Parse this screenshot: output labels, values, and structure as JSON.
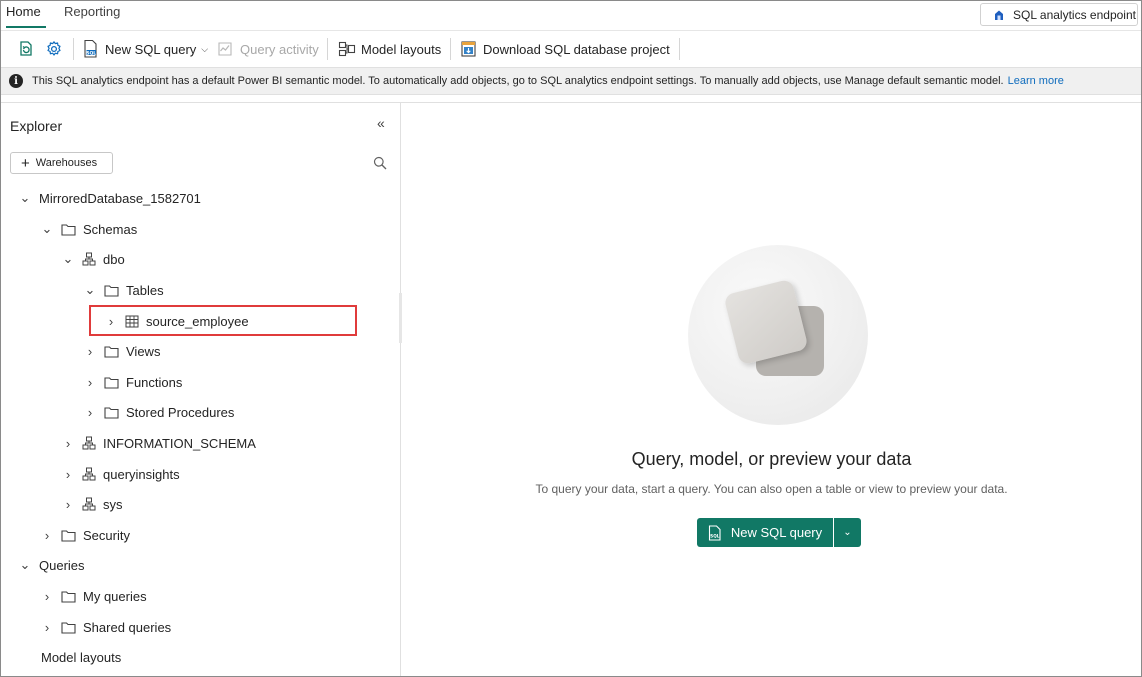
{
  "tabs": {
    "home": "Home",
    "reporting": "Reporting"
  },
  "endpoint_selector": {
    "label": "SQL analytics endpoint"
  },
  "toolbar": {
    "new_sql_query": "New SQL query",
    "query_activity": "Query activity",
    "model_layouts": "Model layouts",
    "download_project": "Download SQL database project"
  },
  "infobar": {
    "message": "This SQL analytics endpoint has a default Power BI semantic model. To automatically add objects, go to SQL analytics endpoint settings. To manually add objects, use Manage default semantic model.",
    "link": "Learn more"
  },
  "explorer": {
    "title": "Explorer",
    "add_button": "Warehouses",
    "tree": {
      "database": "MirroredDatabase_1582701",
      "schemas": "Schemas",
      "dbo": "dbo",
      "tables": "Tables",
      "source_employee": "source_employee",
      "views": "Views",
      "functions": "Functions",
      "stored_procedures": "Stored Procedures",
      "information_schema": "INFORMATION_SCHEMA",
      "queryinsights": "queryinsights",
      "sys": "sys",
      "security": "Security",
      "queries": "Queries",
      "my_queries": "My queries",
      "shared_queries": "Shared queries",
      "model_layouts": "Model layouts"
    }
  },
  "main": {
    "title": "Query, model, or preview your data",
    "subtitle": "To query your data, start a query. You can also open a table or view to preview your data.",
    "cta_label": "New SQL query"
  },
  "colors": {
    "accent": "#117865",
    "highlight": "#e03b3b",
    "link": "#0f6cbd"
  }
}
